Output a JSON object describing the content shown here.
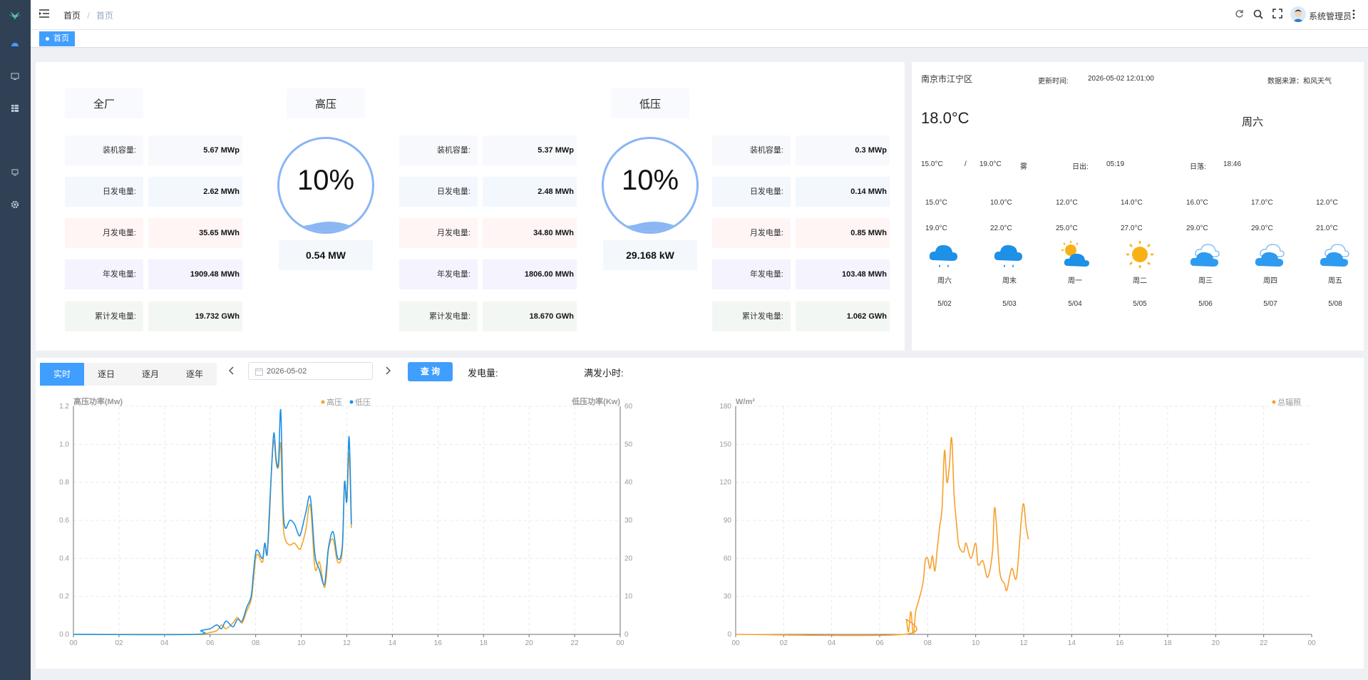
{
  "header": {
    "breadcrumb": [
      "首页",
      "首页"
    ],
    "user": "系统管理员",
    "tag": "首页"
  },
  "plant": {
    "groups": [
      {
        "title": "全厂",
        "rows": [
          [
            "装机容量:",
            "5.67 MWp"
          ],
          [
            "日发电量:",
            "2.62 MWh"
          ],
          [
            "月发电量:",
            "35.65 MWh"
          ],
          [
            "年发电量:",
            "1909.48 MWh"
          ],
          [
            "累计发电量:",
            "19.732 GWh"
          ]
        ]
      },
      {
        "title": "高压",
        "gauge": "10%",
        "gauge_level": 0.1,
        "power": "0.54 MW",
        "rows": [
          [
            "装机容量:",
            "5.37 MWp"
          ],
          [
            "日发电量:",
            "2.48 MWh"
          ],
          [
            "月发电量:",
            "34.80 MWh"
          ],
          [
            "年发电量:",
            "1806.00 MWh"
          ],
          [
            "累计发电量:",
            "18.670 GWh"
          ]
        ]
      },
      {
        "title": "低压",
        "gauge": "10%",
        "gauge_level": 0.1,
        "power": "29.168 kW",
        "rows": [
          [
            "装机容量:",
            "0.3 MWp"
          ],
          [
            "日发电量:",
            "0.14 MWh"
          ],
          [
            "月发电量:",
            "0.85 MWh"
          ],
          [
            "年发电量:",
            "103.48 MWh"
          ],
          [
            "累计发电量:",
            "1.062 GWh"
          ]
        ]
      }
    ]
  },
  "weather": {
    "city": "南京市江宁区",
    "update_label": "更新时间:",
    "update_time": "2026-05-02 12:01:00",
    "source": "数据来源：和风天气",
    "temp": "18.0°C",
    "weekday": "周六",
    "low": "15.0°C",
    "sep": "/",
    "high": "19.0°C",
    "cond": "雾",
    "sunrise_label": "日出:",
    "sunrise": "05:19",
    "sunset_label": "日落:",
    "sunset": "18:46",
    "forecast": [
      {
        "low": "15.0°C",
        "high": "19.0°C",
        "icon": "rain-cloud",
        "day": "周六",
        "date": "5/02"
      },
      {
        "low": "10.0°C",
        "high": "22.0°C",
        "icon": "rain-cloud",
        "day": "周末",
        "date": "5/03"
      },
      {
        "low": "12.0°C",
        "high": "25.0°C",
        "icon": "partly-sunny",
        "day": "周一",
        "date": "5/04"
      },
      {
        "low": "14.0°C",
        "high": "27.0°C",
        "icon": "sunny",
        "day": "周二",
        "date": "5/05"
      },
      {
        "low": "16.0°C",
        "high": "29.0°C",
        "icon": "cloudy",
        "day": "周三",
        "date": "5/06"
      },
      {
        "low": "17.0°C",
        "high": "29.0°C",
        "icon": "cloudy",
        "day": "周四",
        "date": "5/07"
      },
      {
        "low": "12.0°C",
        "high": "21.0°C",
        "icon": "cloudy",
        "day": "周五",
        "date": "5/08"
      }
    ]
  },
  "controls": {
    "tabs": [
      "实时",
      "逐日",
      "逐月",
      "逐年"
    ],
    "date": "2026-05-02",
    "query": "查 询",
    "gen_label": "发电量:",
    "hours_label": "满发小时:"
  },
  "colors": {
    "high": "#f5a623",
    "low": "#1e90e6",
    "irr": "#f7a02c",
    "accent": "#409eff"
  },
  "chart_data": [
    {
      "type": "line",
      "xlabel_ticks": [
        "00",
        "02",
        "04",
        "06",
        "08",
        "10",
        "12",
        "14",
        "16",
        "18",
        "20",
        "22",
        "00"
      ],
      "ylabel": "高压功率(Mw)",
      "ylabel_right": "低压功率(Kw)",
      "ylim": [
        0,
        1.2
      ],
      "ylim_right": [
        0,
        60
      ],
      "yticks": [
        "0.0",
        "0.2",
        "0.4",
        "0.6",
        "0.8",
        "1.0",
        "1.2"
      ],
      "yticks_right": [
        "0",
        "10",
        "20",
        "30",
        "40",
        "50",
        "60"
      ],
      "legend": "top-right",
      "series": [
        {
          "name": "高压",
          "axis": "left",
          "x": [
            0,
            5.3,
            5.6,
            6.0,
            6.3,
            6.5,
            6.7,
            7.0,
            7.2,
            7.4,
            7.6,
            7.8,
            7.9,
            8.0,
            8.1,
            8.3,
            8.4,
            8.5,
            8.6,
            8.7,
            8.8,
            8.9,
            9.0,
            9.1,
            9.2,
            9.3,
            9.5,
            9.7,
            9.9,
            10.0,
            10.2,
            10.4,
            10.6,
            10.8,
            11.0,
            11.1,
            11.2,
            11.4,
            11.6,
            11.8,
            11.9,
            12.0,
            12.1,
            12.2
          ],
          "y": [
            0,
            0,
            0,
            0.01,
            0.02,
            0.05,
            0.03,
            0.06,
            0.09,
            0.06,
            0.12,
            0.18,
            0.28,
            0.4,
            0.42,
            0.38,
            0.48,
            0.42,
            0.6,
            0.88,
            1.02,
            0.9,
            0.88,
            1.0,
            0.6,
            0.5,
            0.47,
            0.48,
            0.45,
            0.46,
            0.55,
            0.68,
            0.35,
            0.38,
            0.25,
            0.3,
            0.45,
            0.5,
            0.38,
            0.44,
            0.8,
            0.7,
            0.95,
            0.56
          ]
        },
        {
          "name": "低压",
          "axis": "right",
          "x": [
            0,
            5.3,
            5.6,
            6.0,
            6.3,
            6.5,
            6.7,
            7.0,
            7.2,
            7.4,
            7.6,
            7.8,
            7.9,
            8.0,
            8.1,
            8.3,
            8.4,
            8.5,
            8.6,
            8.7,
            8.8,
            8.9,
            9.0,
            9.1,
            9.2,
            9.3,
            9.5,
            9.7,
            9.9,
            10.0,
            10.2,
            10.4,
            10.6,
            10.8,
            11.0,
            11.1,
            11.2,
            11.4,
            11.6,
            11.8,
            11.9,
            12.0,
            12.1,
            12.2
          ],
          "y": [
            0,
            0,
            1,
            1.5,
            2.5,
            1.5,
            3.5,
            2,
            4,
            3.5,
            7,
            10,
            16,
            21.5,
            22,
            20,
            24,
            21,
            32,
            44,
            53,
            46,
            45,
            59,
            34,
            28,
            30,
            29,
            26,
            27,
            32,
            36,
            21,
            17,
            13,
            17,
            23,
            27,
            20,
            23,
            40,
            35,
            52,
            29
          ]
        }
      ]
    },
    {
      "type": "line",
      "xlabel_ticks": [
        "00",
        "02",
        "04",
        "06",
        "08",
        "10",
        "12",
        "14",
        "16",
        "18",
        "20",
        "22",
        "00"
      ],
      "ylabel": "W/m²",
      "ylim": [
        0,
        180
      ],
      "yticks": [
        "0",
        "30",
        "60",
        "90",
        "120",
        "150",
        "180"
      ],
      "legend": "top-right",
      "series": [
        {
          "name": "总辐照",
          "x": [
            0,
            7.0,
            7.1,
            7.2,
            7.3,
            7.4,
            7.5,
            7.6,
            7.8,
            7.9,
            8.0,
            8.1,
            8.2,
            8.3,
            8.4,
            8.5,
            8.6,
            8.7,
            8.8,
            8.9,
            9.0,
            9.1,
            9.2,
            9.3,
            9.5,
            9.6,
            9.8,
            10.0,
            10.1,
            10.3,
            10.5,
            10.7,
            10.8,
            11.0,
            11.2,
            11.3,
            11.5,
            11.7,
            11.9,
            12.0,
            12.1,
            12.2
          ],
          "y": [
            0,
            0,
            12,
            2,
            18,
            0,
            18,
            25,
            40,
            58,
            60,
            52,
            62,
            50,
            68,
            85,
            100,
            145,
            120,
            132,
            155,
            110,
            88,
            70,
            65,
            72,
            60,
            72,
            55,
            58,
            45,
            65,
            100,
            50,
            40,
            35,
            52,
            45,
            90,
            103,
            85,
            75
          ]
        }
      ]
    }
  ]
}
